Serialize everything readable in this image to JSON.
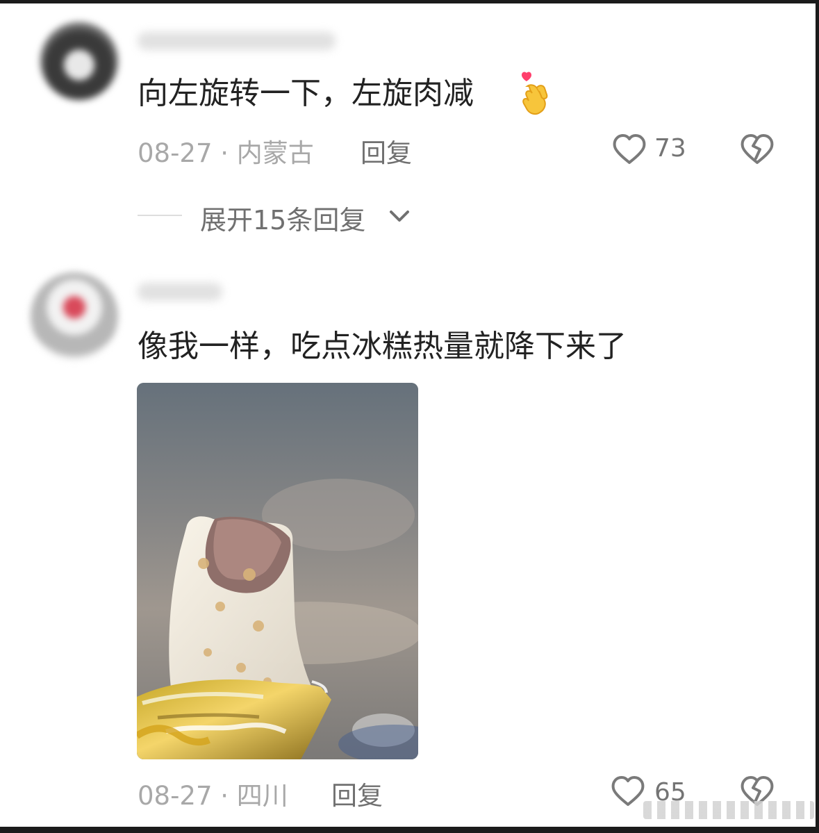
{
  "comments": [
    {
      "text": "向左旋转一下，左旋肉减",
      "date_location": "08-27 · 内蒙古",
      "reply_label": "回复",
      "likes": "73",
      "expand_replies": "展开15条回复",
      "emoji": "finger-heart-emoji",
      "avatar_icon": "avatar-icon"
    },
    {
      "text": "像我一样，吃点冰糕热量就降下来了",
      "date_location": "08-27 · 四川",
      "reply_label": "回复",
      "likes": "65",
      "image_label": "ice-cream-photo",
      "avatar_icon": "avatar-icon"
    }
  ],
  "colors": {
    "background": "#ffffff",
    "text_primary": "#222222",
    "text_meta": "#a8a8a8",
    "text_secondary": "#707070",
    "icon": "#7a7a7a",
    "accent_heart": "#ff3f6c",
    "emoji_yellow": "#f7c53b"
  }
}
